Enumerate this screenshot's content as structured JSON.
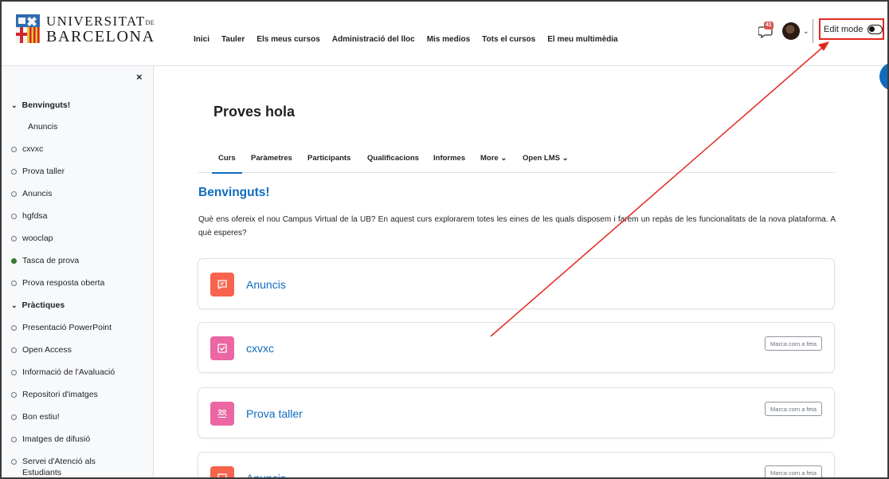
{
  "brand": {
    "line1": "UNIVERSITAT",
    "line1_small": "DE",
    "line2": "BARCELONA"
  },
  "nav": {
    "links": [
      "Inici",
      "Tauler",
      "Els meus cursos",
      "Administració del lloc",
      "Mis medios",
      "Tots el cursos",
      "El meu multimèdia"
    ],
    "message_count": "41",
    "edit_mode_label": "Edit mode"
  },
  "sidebar": {
    "close_label": "×",
    "items": [
      {
        "label": "Benvinguts!",
        "type": "section"
      },
      {
        "label": "Anuncis",
        "type": "sub"
      },
      {
        "label": "cxvxc",
        "type": "item"
      },
      {
        "label": "Prova taller",
        "type": "item"
      },
      {
        "label": "Anuncis",
        "type": "item"
      },
      {
        "label": "hgfdsa",
        "type": "item"
      },
      {
        "label": "wooclap",
        "type": "item"
      },
      {
        "label": "Tasca de prova",
        "type": "done"
      },
      {
        "label": "Prova resposta oberta",
        "type": "item"
      },
      {
        "label": "Pràctiques",
        "type": "section"
      },
      {
        "label": "Presentació PowerPoint",
        "type": "item"
      },
      {
        "label": "Open Access",
        "type": "item"
      },
      {
        "label": "Informació de l'Avaluació",
        "type": "item"
      },
      {
        "label": "Repositori d'imatges",
        "type": "item"
      },
      {
        "label": "Bon estiu!",
        "type": "item"
      },
      {
        "label": "Imatges de difusió",
        "type": "item"
      },
      {
        "label": "Servei d'Atenció als",
        "type": "item"
      },
      {
        "label": "Estudiants",
        "type": "continuation"
      }
    ]
  },
  "course": {
    "title": "Proves hola",
    "tabs": [
      "Curs",
      "Paràmetres",
      "Participants",
      "Qualificacions",
      "Informes",
      "More ⌄",
      "Open LMS ⌄"
    ],
    "section_title": "Benvinguts!",
    "section_description": "Què ens ofereix el nou Campus Virtual de la UB? En aquest curs explorarem totes les eines de les quals disposem i farem un repàs de les funcionalitats de la nova plataforma. A què esperes?",
    "activities": [
      {
        "name": "Anuncis",
        "icon": "forum-icon",
        "color": "#f7634d",
        "mark_label": ""
      },
      {
        "name": "cxvxc",
        "icon": "assignment-icon",
        "color": "#eb66a2",
        "mark_label": "Marca com a feta"
      },
      {
        "name": "Prova taller",
        "icon": "workshop-icon",
        "color": "#eb66a2",
        "mark_label": "Marca com a feta"
      },
      {
        "name": "Anuncis",
        "icon": "forum-icon",
        "color": "#f7634d",
        "mark_label": "Marca com a feta"
      }
    ]
  },
  "colors": {
    "accent": "#0f6cbf",
    "annotation": "#e3261c"
  }
}
